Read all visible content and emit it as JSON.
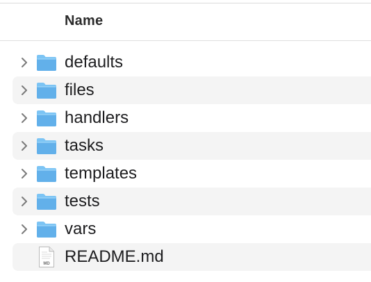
{
  "header": {
    "name_column": "Name"
  },
  "rows": [
    {
      "label": "defaults",
      "type": "folder",
      "icon": "folder-icon"
    },
    {
      "label": "files",
      "type": "folder",
      "icon": "folder-icon"
    },
    {
      "label": "handlers",
      "type": "folder",
      "icon": "folder-icon"
    },
    {
      "label": "tasks",
      "type": "folder",
      "icon": "folder-icon"
    },
    {
      "label": "templates",
      "type": "folder",
      "icon": "folder-icon"
    },
    {
      "label": "tests",
      "type": "folder",
      "icon": "folder-icon"
    },
    {
      "label": "vars",
      "type": "folder",
      "icon": "folder-icon"
    },
    {
      "label": "README.md",
      "type": "file",
      "icon": "markdown-file-icon",
      "icon_badge": "MD"
    }
  ],
  "colors": {
    "folder_body": "#7cc4f4",
    "folder_front": "#66b4ec",
    "stripe": "#f4f4f4",
    "text": "#1d1d1f"
  }
}
